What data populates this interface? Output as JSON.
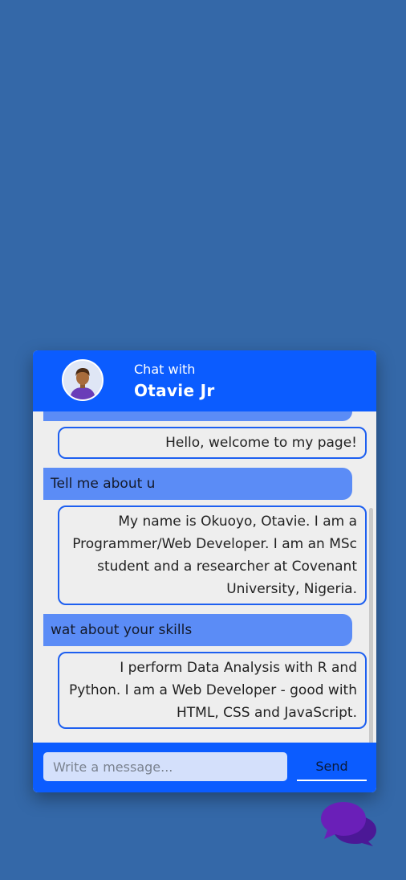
{
  "header": {
    "subtitle": "Chat with",
    "title": "Otavie Jr"
  },
  "messages": [
    {
      "sender": "user",
      "text": ""
    },
    {
      "sender": "bot",
      "text": "Hello, welcome to my page!"
    },
    {
      "sender": "user",
      "text": "Tell me about u"
    },
    {
      "sender": "bot",
      "text": "My name is Okuoyo, Otavie. I am a Programmer/Web Developer. I am an MSc student and a researcher at Covenant University, Nigeria."
    },
    {
      "sender": "user",
      "text": "wat about your skills"
    },
    {
      "sender": "bot",
      "text": "I perform Data Analysis with R and Python. I am a Web Developer - good with HTML, CSS and JavaScript."
    }
  ],
  "composer": {
    "placeholder": "Write a message...",
    "value": "",
    "send_label": "Send"
  },
  "icons": {
    "avatar": "user-avatar",
    "toggle": "chat-bubbles-icon"
  },
  "colors": {
    "page_background": "#3468a8",
    "header": "#0b5cff",
    "user_bubble": "#5b8cf6",
    "bot_border": "#1d5ff0",
    "toggle_icon": "#6a1fb8"
  }
}
